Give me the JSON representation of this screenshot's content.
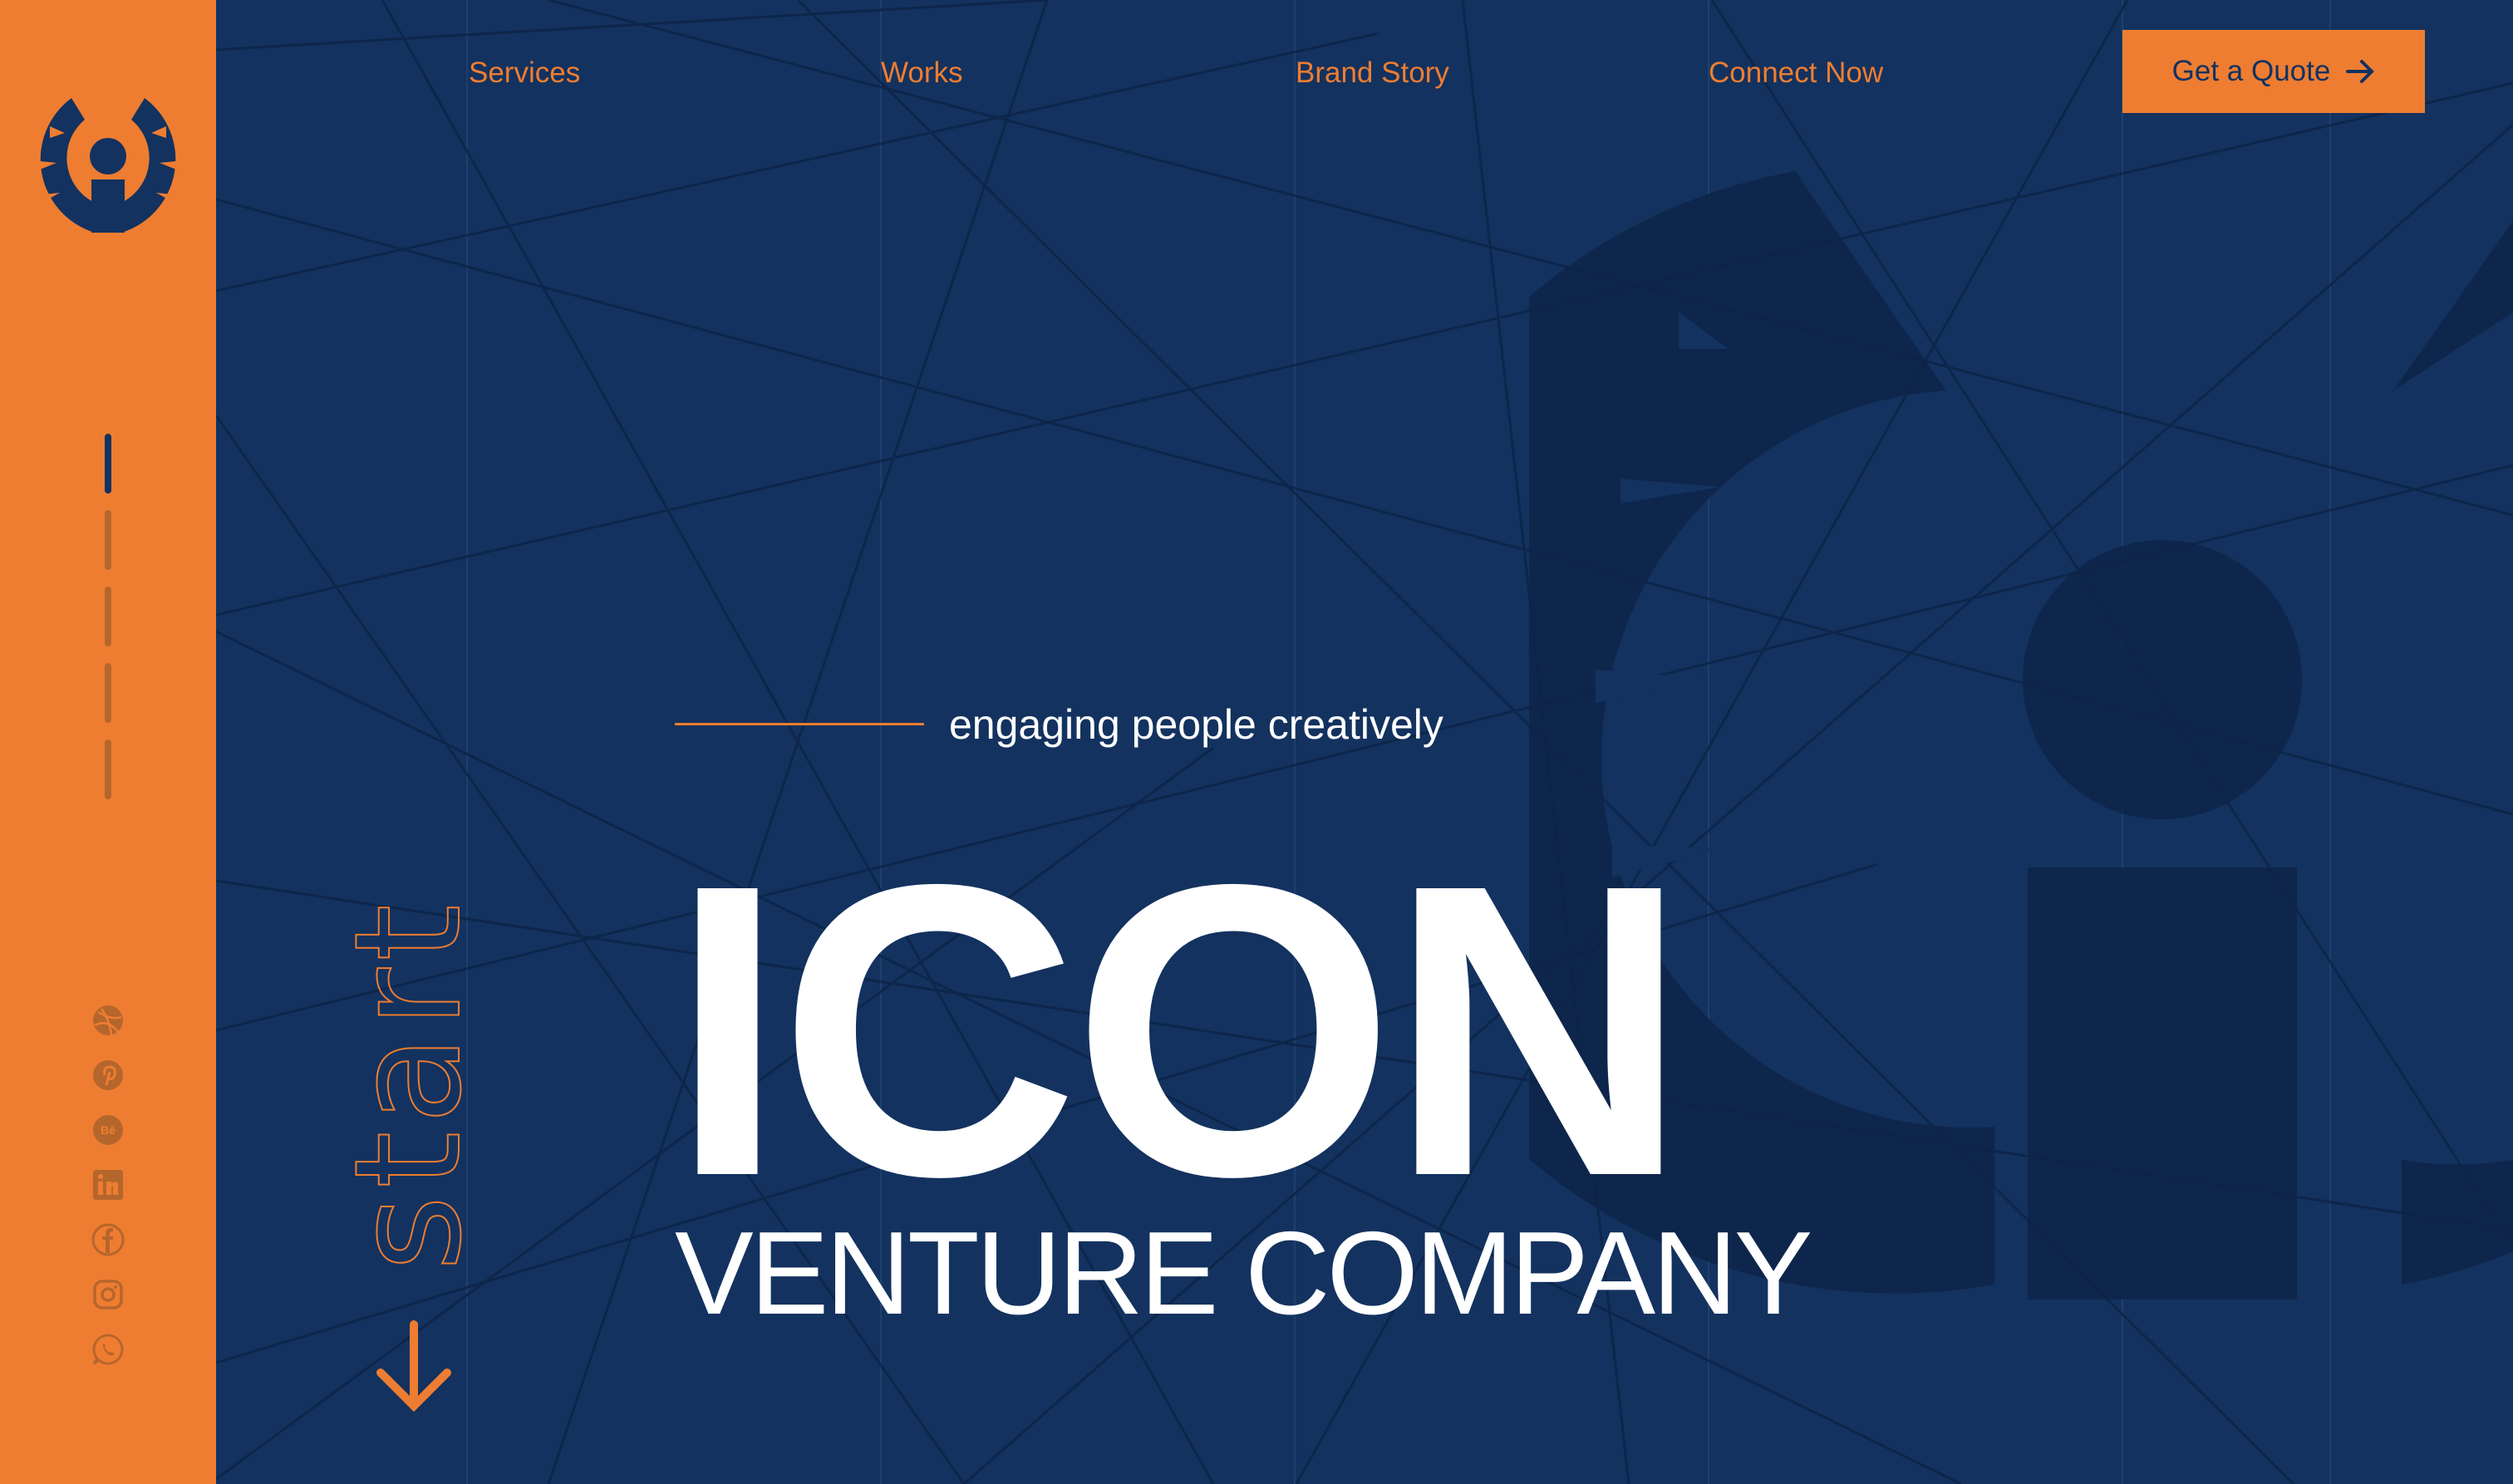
{
  "brand": {
    "logo": "icon-venture-logo",
    "colors": {
      "primary_navy": "#13325f",
      "accent_orange": "#ee7d31",
      "watermark_navy": "#0e2548",
      "text_white": "#ffffff"
    }
  },
  "nav": {
    "items": [
      {
        "label": "Services"
      },
      {
        "label": "Works"
      },
      {
        "label": "Brand Story"
      },
      {
        "label": "Connect Now"
      }
    ],
    "cta_label": "Get a Quote",
    "cta_icon": "arrow-right-icon"
  },
  "progress": {
    "total_sections": 5,
    "active_section": 1
  },
  "socials": [
    {
      "name": "dribbble",
      "icon": "dribbble-icon"
    },
    {
      "name": "pinterest",
      "icon": "pinterest-icon"
    },
    {
      "name": "behance",
      "icon": "behance-icon",
      "glyph": "Bē"
    },
    {
      "name": "linkedin",
      "icon": "linkedin-icon",
      "glyph": "in"
    },
    {
      "name": "facebook",
      "icon": "facebook-icon",
      "glyph": "f"
    },
    {
      "name": "instagram",
      "icon": "instagram-icon"
    },
    {
      "name": "whatsapp",
      "icon": "whatsapp-icon"
    }
  ],
  "scroll": {
    "label": "start",
    "icon": "arrow-down-icon"
  },
  "hero": {
    "tagline": "engaging people creatively",
    "title": "ICON",
    "subtitle": "VENTURE COMPANY"
  }
}
